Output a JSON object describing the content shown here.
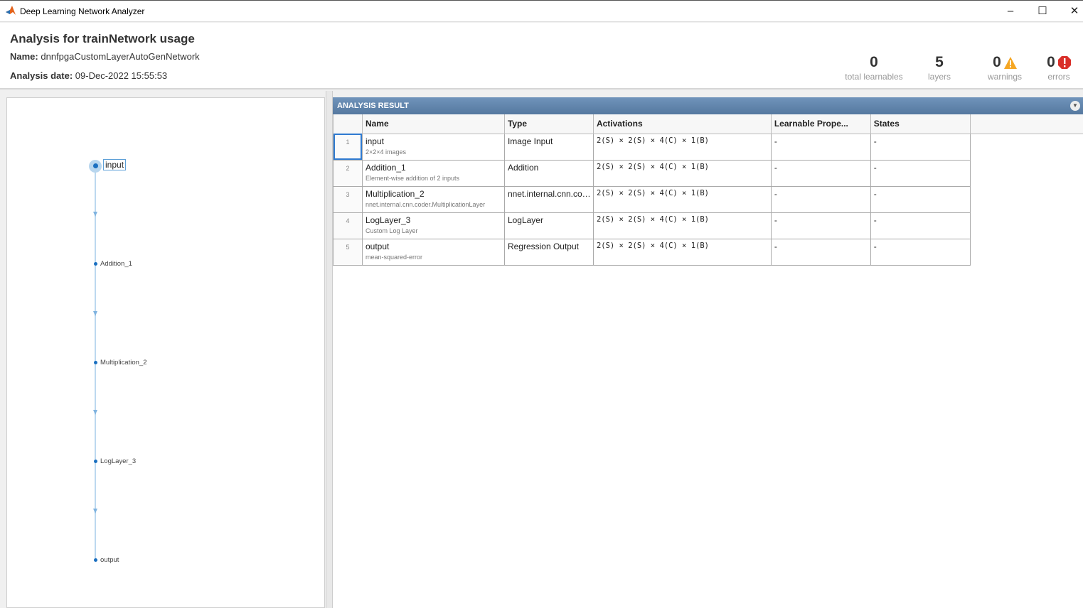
{
  "window": {
    "title": "Deep Learning Network Analyzer",
    "minimize": "–",
    "maximize": "☐",
    "close": "✕"
  },
  "header": {
    "title": "Analysis for trainNetwork usage",
    "name_label": "Name:",
    "name_value": "dnnfpgaCustomLayerAutoGenNetwork",
    "date_label": "Analysis date:",
    "date_value": "09-Dec-2022 15:55:53"
  },
  "stats": [
    {
      "value": "0",
      "label": "total learnables"
    },
    {
      "value": "5",
      "label": "layers"
    },
    {
      "value": "0",
      "label": "warnings"
    },
    {
      "value": "0",
      "label": "errors"
    }
  ],
  "graph": {
    "nodes": [
      "input",
      "Addition_1",
      "Multiplication_2",
      "LogLayer_3",
      "output"
    ]
  },
  "panel": {
    "title": "ANALYSIS RESULT"
  },
  "table": {
    "columns": [
      "Name",
      "Type",
      "Activations",
      "Learnable Prope...",
      "States"
    ],
    "rows": [
      {
        "num": "1",
        "name": "input",
        "desc": "2×2×4 images",
        "type": "Image Input",
        "act": "2(S) × 2(S) × 4(C) × 1(B)",
        "learn": "-",
        "states": "-"
      },
      {
        "num": "2",
        "name": "Addition_1",
        "desc": "Element-wise addition of 2 inputs",
        "type": "Addition",
        "act": "2(S) × 2(S) × 4(C) × 1(B)",
        "learn": "-",
        "states": "-"
      },
      {
        "num": "3",
        "name": "Multiplication_2",
        "desc": "nnet.internal.cnn.coder.MultiplicationLayer",
        "type": "nnet.internal.cnn.co…",
        "act": "2(S) × 2(S) × 4(C) × 1(B)",
        "learn": "-",
        "states": "-"
      },
      {
        "num": "4",
        "name": "LogLayer_3",
        "desc": "Custom Log Layer",
        "type": "LogLayer",
        "act": "2(S) × 2(S) × 4(C) × 1(B)",
        "learn": "-",
        "states": "-"
      },
      {
        "num": "5",
        "name": "output",
        "desc": "mean-squared-error",
        "type": "Regression Output",
        "act": "2(S) × 2(S) × 4(C) × 1(B)",
        "learn": "-",
        "states": "-"
      }
    ]
  }
}
